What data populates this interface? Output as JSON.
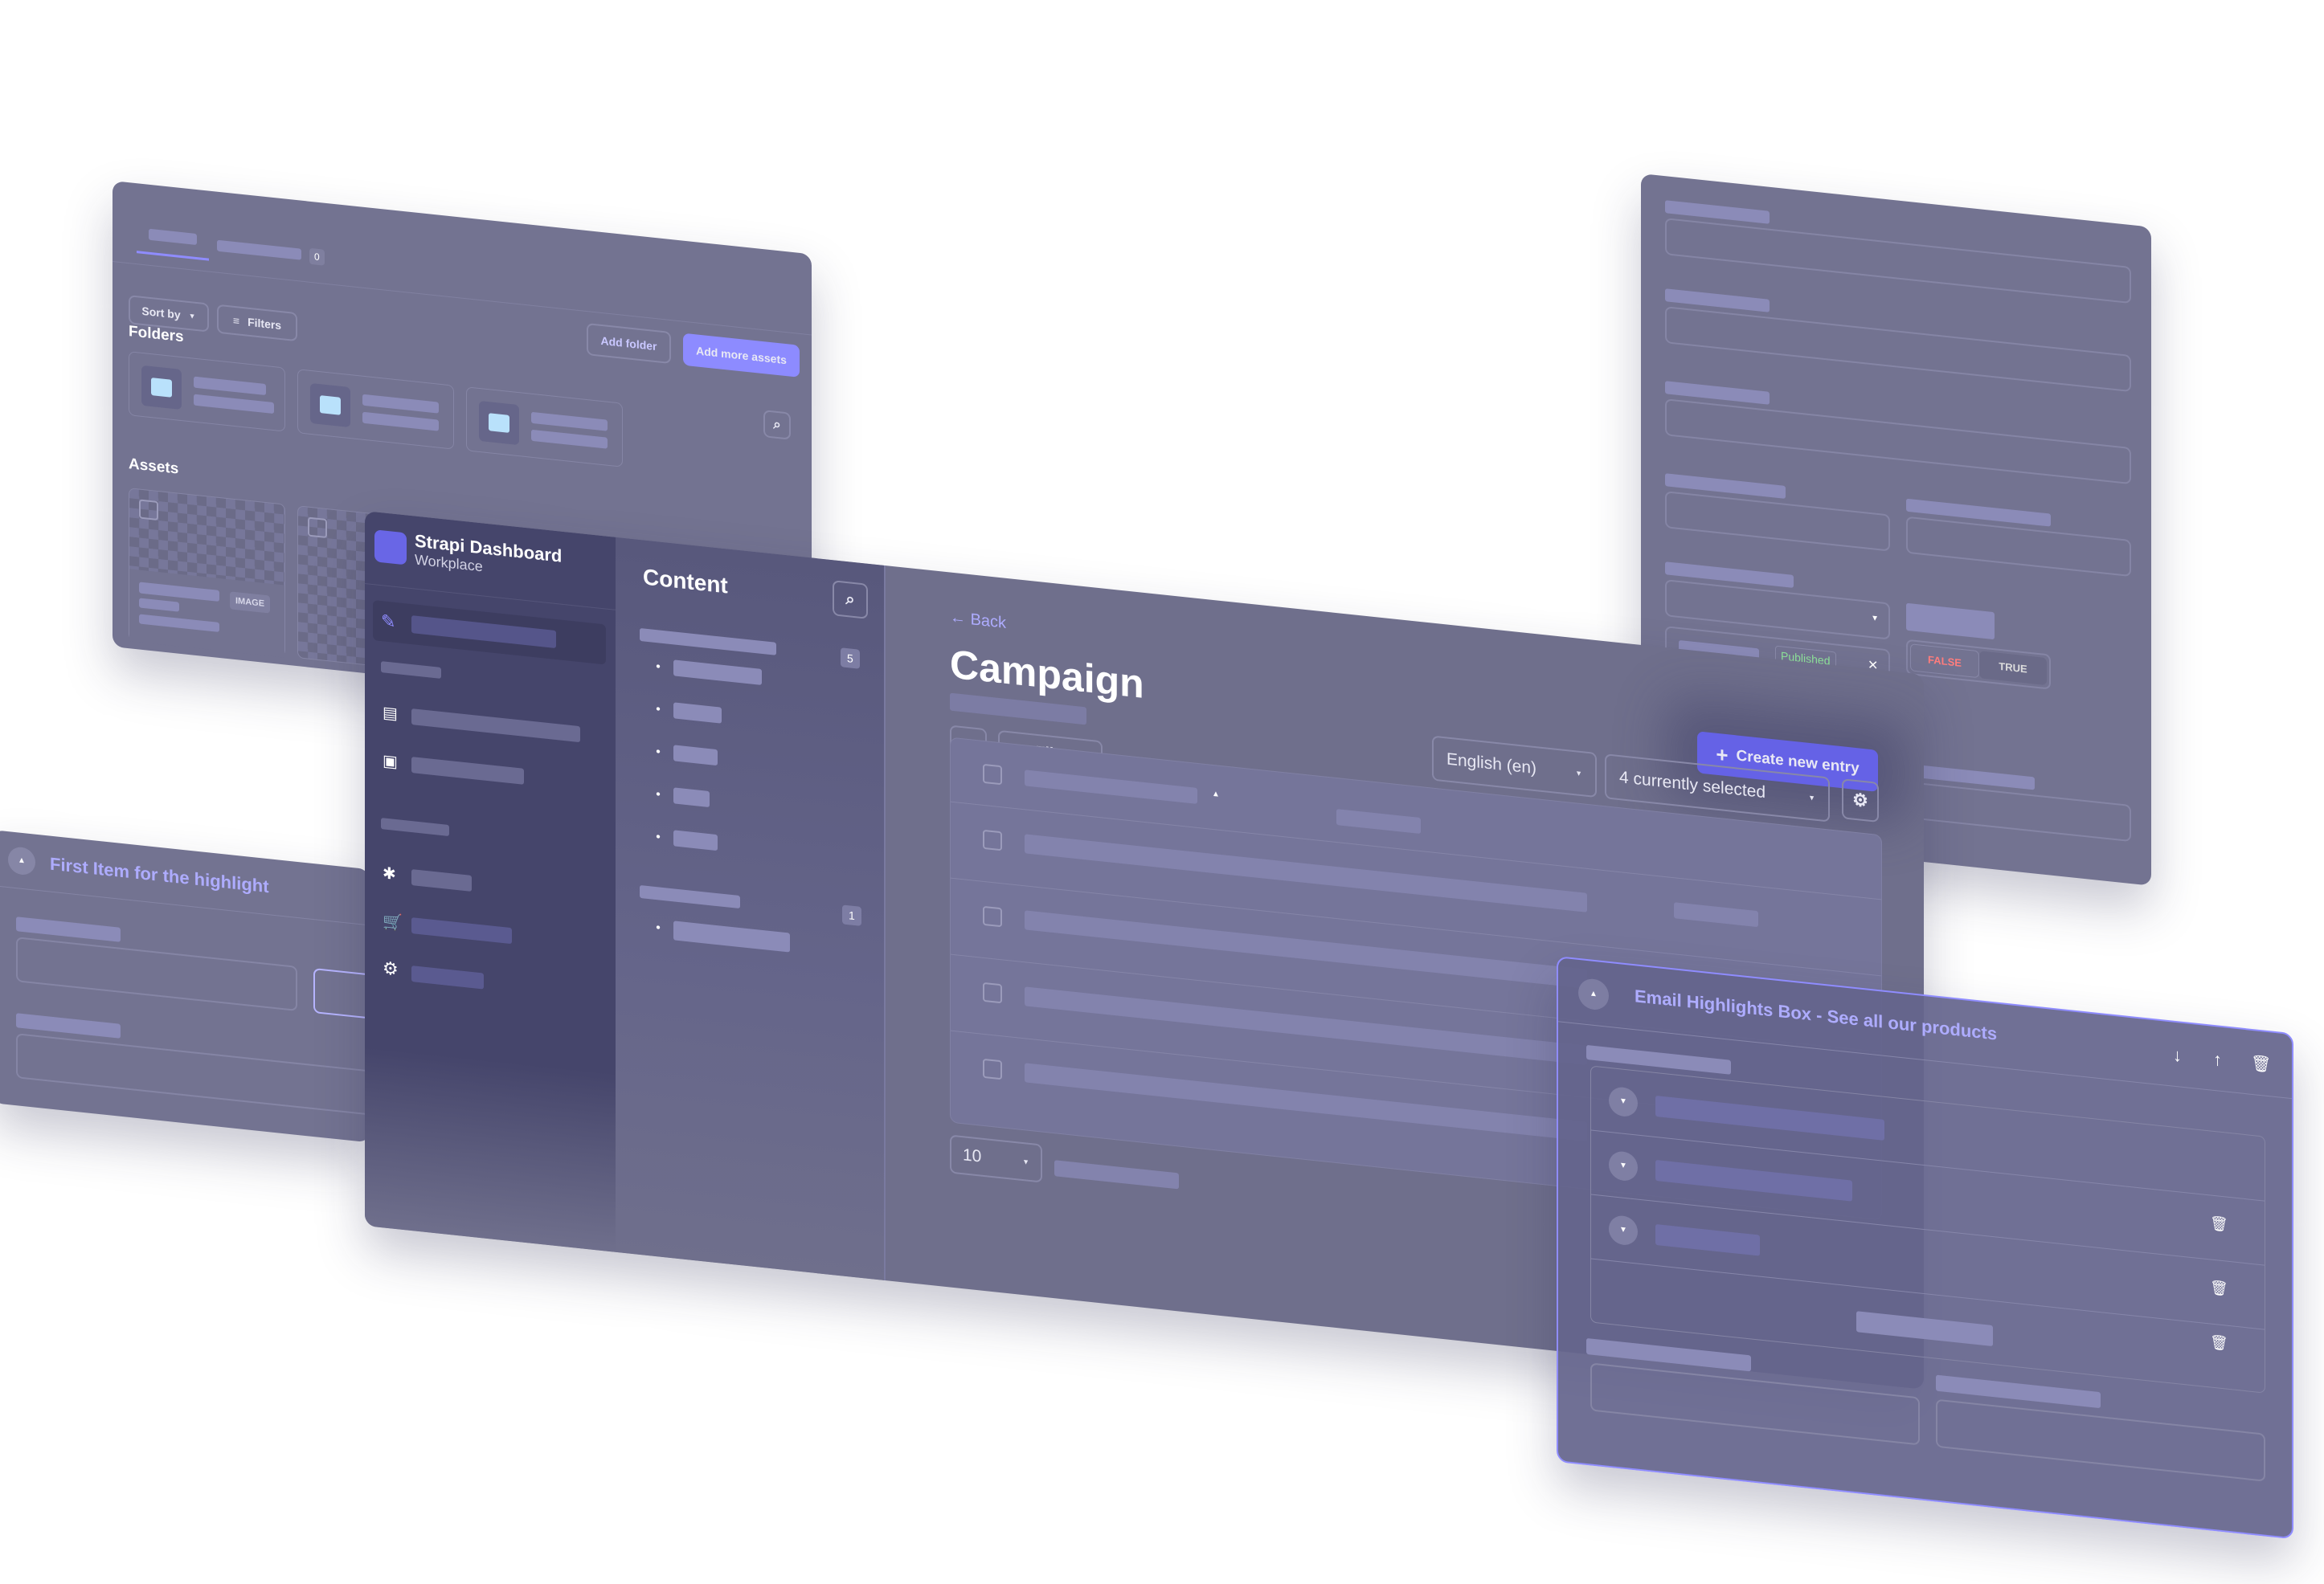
{
  "media": {
    "tab_count": "0",
    "add_folder": "Add folder",
    "add_assets": "Add more assets",
    "sort_by": "Sort by",
    "filters": "Filters",
    "folders_title": "Folders",
    "assets_title": "Assets",
    "asset_badge": "IMAGE"
  },
  "form": {
    "status": "Published",
    "false_label": "FALSE",
    "true_label": "TRUE"
  },
  "highlight": {
    "title": "First Item for the highlight"
  },
  "app": {
    "name": "Strapi Dashboard",
    "workspace": "Workplace",
    "nav_title": "Content",
    "count_a": "5",
    "count_b": "1"
  },
  "main": {
    "back": "Back",
    "title": "Campaign",
    "create": "Create new entry",
    "filters": "Filters",
    "locale": "English (en)",
    "columns": "4 currently selected",
    "page_size": "10"
  },
  "email": {
    "title": "Email Highlights Box - See all our products"
  },
  "colors": {
    "panel": "#737391",
    "sidebar": "#434367",
    "accent": "#7b79ff",
    "primary_button": "#6562e6",
    "danger": "#ff7d7d",
    "success": "#8fe59a"
  }
}
